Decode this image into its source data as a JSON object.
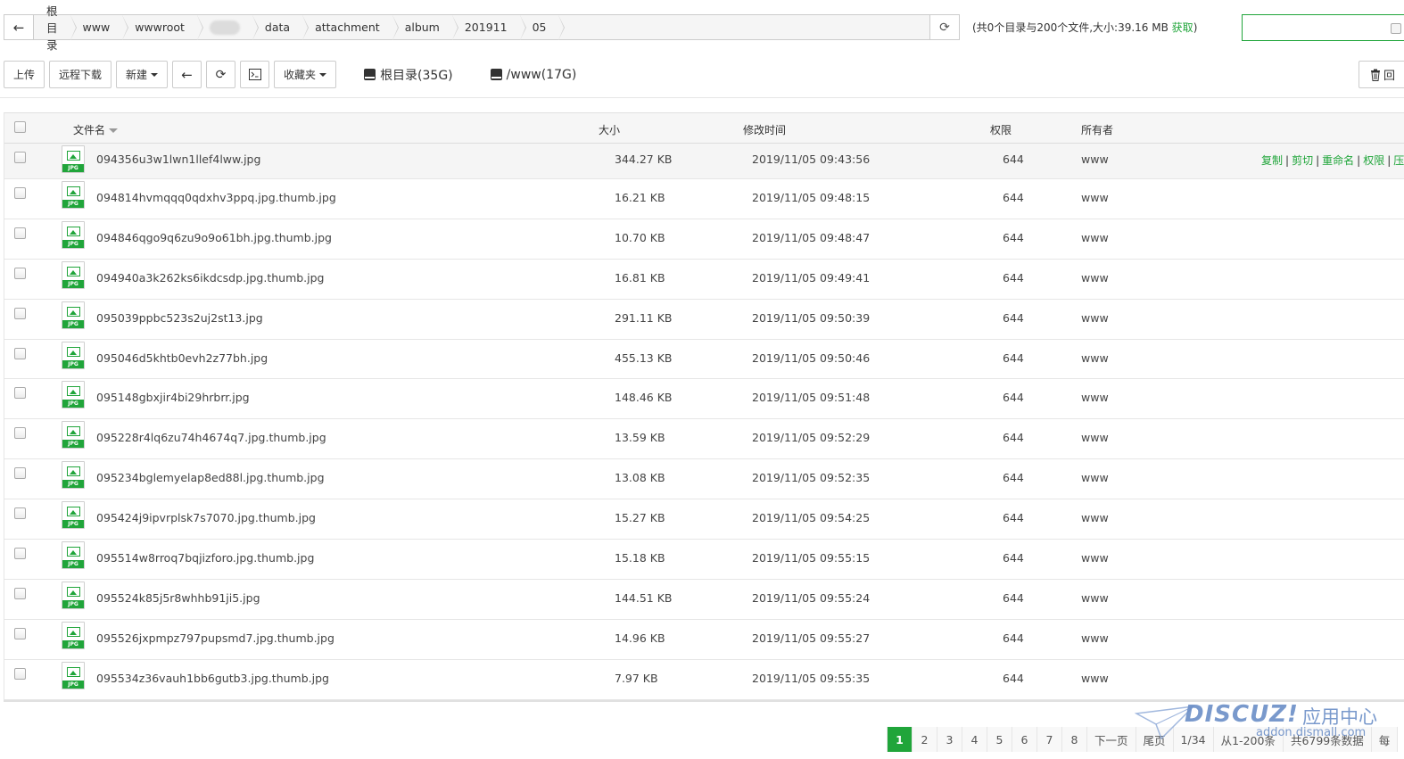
{
  "breadcrumbs": [
    "根目录",
    "www",
    "wwwroot",
    "",
    "data",
    "attachment",
    "album",
    "201911",
    "05"
  ],
  "dir_info": {
    "summary": "(共0个目录与200个文件,大小:39.16 MB",
    "fetch": "获取",
    "close": ")"
  },
  "toolbar": {
    "upload": "上传",
    "remote_download": "远程下载",
    "new": "新建",
    "favorites": "收藏夹",
    "disk_root": "根目录(35G)",
    "disk_www": "/www(17G)",
    "recycle": "回"
  },
  "table": {
    "headers": {
      "name": "文件名",
      "size": "大小",
      "mtime": "修改时间",
      "perm": "权限",
      "owner": "所有者"
    },
    "file_type_tag": "JPG",
    "row_actions": [
      "复制",
      "剪切",
      "重命名",
      "权限",
      "压"
    ],
    "rows": [
      {
        "name": "094356u3w1lwn1llef4lww.jpg",
        "size": "344.27 KB",
        "mtime": "2019/11/05 09:43:56",
        "perm": "644",
        "owner": "www"
      },
      {
        "name": "094814hvmqqq0qdxhv3ppq.jpg.thumb.jpg",
        "size": "16.21 KB",
        "mtime": "2019/11/05 09:48:15",
        "perm": "644",
        "owner": "www"
      },
      {
        "name": "094846qgo9q6zu9o9o61bh.jpg.thumb.jpg",
        "size": "10.70 KB",
        "mtime": "2019/11/05 09:48:47",
        "perm": "644",
        "owner": "www"
      },
      {
        "name": "094940a3k262ks6ikdcsdp.jpg.thumb.jpg",
        "size": "16.81 KB",
        "mtime": "2019/11/05 09:49:41",
        "perm": "644",
        "owner": "www"
      },
      {
        "name": "095039ppbc523s2uj2st13.jpg",
        "size": "291.11 KB",
        "mtime": "2019/11/05 09:50:39",
        "perm": "644",
        "owner": "www"
      },
      {
        "name": "095046d5khtb0evh2z77bh.jpg",
        "size": "455.13 KB",
        "mtime": "2019/11/05 09:50:46",
        "perm": "644",
        "owner": "www"
      },
      {
        "name": "095148gbxjir4bi29hrbrr.jpg",
        "size": "148.46 KB",
        "mtime": "2019/11/05 09:51:48",
        "perm": "644",
        "owner": "www"
      },
      {
        "name": "095228r4lq6zu74h4674q7.jpg.thumb.jpg",
        "size": "13.59 KB",
        "mtime": "2019/11/05 09:52:29",
        "perm": "644",
        "owner": "www"
      },
      {
        "name": "095234bglemyelap8ed88l.jpg.thumb.jpg",
        "size": "13.08 KB",
        "mtime": "2019/11/05 09:52:35",
        "perm": "644",
        "owner": "www"
      },
      {
        "name": "095424j9ipvrplsk7s7070.jpg.thumb.jpg",
        "size": "15.27 KB",
        "mtime": "2019/11/05 09:54:25",
        "perm": "644",
        "owner": "www"
      },
      {
        "name": "095514w8rroq7bqjizforo.jpg.thumb.jpg",
        "size": "15.18 KB",
        "mtime": "2019/11/05 09:55:15",
        "perm": "644",
        "owner": "www"
      },
      {
        "name": "095524k85j5r8whhb91ji5.jpg",
        "size": "144.51 KB",
        "mtime": "2019/11/05 09:55:24",
        "perm": "644",
        "owner": "www"
      },
      {
        "name": "095526jxpmpz797pupsmd7.jpg.thumb.jpg",
        "size": "14.96 KB",
        "mtime": "2019/11/05 09:55:27",
        "perm": "644",
        "owner": "www"
      },
      {
        "name": "095534z36vauh1bb6gutb3.jpg.thumb.jpg",
        "size": "7.97 KB",
        "mtime": "2019/11/05 09:55:35",
        "perm": "644",
        "owner": "www"
      }
    ]
  },
  "pagination": {
    "pages": [
      "1",
      "2",
      "3",
      "4",
      "5",
      "6",
      "7",
      "8"
    ],
    "current": "1",
    "next": "下一页",
    "last": "尾页",
    "page_of": "1/34",
    "range": "从1-200条",
    "total": "共6799条数据",
    "extra": "每"
  },
  "watermark": {
    "brand": "DISCUZ!",
    "cn": "应用中心",
    "url": "addon.dismall.com"
  },
  "colors": {
    "accent": "#20a53a",
    "watermark": "#6b8ec7"
  }
}
